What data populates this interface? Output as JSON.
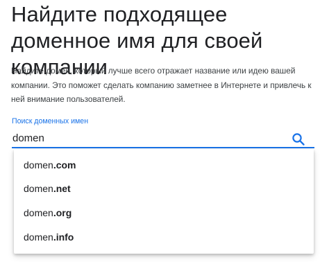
{
  "headline": "Найдите подходящее доменное имя для своей компании",
  "description": "Найдите домен, который лучше всего отражает название или идею вашей компании. Это поможет сделать компанию заметнее в Интернете и привлечь к ней внимание пользователей.",
  "search": {
    "label": "Поиск доменных имен",
    "value": "domen",
    "icon": "search-icon",
    "accent_color": "#1a73e8"
  },
  "suggestions": [
    {
      "name": "domen",
      "tld": ".com"
    },
    {
      "name": "domen",
      "tld": ".net"
    },
    {
      "name": "domen",
      "tld": ".org"
    },
    {
      "name": "domen",
      "tld": ".info"
    }
  ]
}
